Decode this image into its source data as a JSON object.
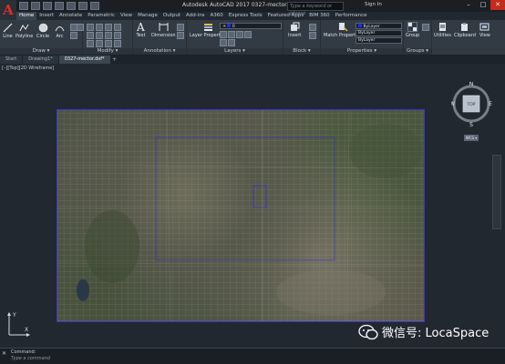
{
  "title_bar": {
    "logo_letter": "A",
    "window_title": "Autodesk AutoCAD 2017      0327-mector.dxf",
    "search_placeholder": "Type a keyword or phrase",
    "sign_in": "Sign In",
    "controls": [
      "–",
      "□",
      "✕"
    ]
  },
  "ribbon_tabs": [
    "Home",
    "Insert",
    "Annotate",
    "Parametric",
    "View",
    "Manage",
    "Output",
    "Add-ins",
    "A360",
    "Express Tools",
    "Featured Apps",
    "BIM 360",
    "Performance"
  ],
  "ribbon": {
    "draw": {
      "label": "Draw ▾",
      "tools": [
        "Line",
        "Polyline",
        "Circle",
        "Arc"
      ]
    },
    "modify": {
      "label": "Modify ▾"
    },
    "annotation": {
      "label": "Annotation ▾",
      "tools": [
        "Text",
        "Dimension"
      ]
    },
    "layers": {
      "label": "Layers ▾",
      "tools": [
        "Layer Properties"
      ],
      "layer_value": "0"
    },
    "block": {
      "label": "Block ▾",
      "tools": [
        "Insert"
      ]
    },
    "properties": {
      "label": "Properties ▾",
      "tools": [
        "Match Properties"
      ],
      "values": [
        "ByLayer",
        "ByLayer",
        "ByLayer"
      ]
    },
    "groups": {
      "label": "Groups ▾",
      "tools": [
        "Group"
      ]
    },
    "utilities": {
      "label": "Utilities"
    },
    "clipboard": {
      "label": "Clipboard"
    },
    "view": {
      "label": "View"
    }
  },
  "file_tabs": [
    "Start",
    "Drawing1*",
    "0327-mector.dxf*"
  ],
  "viewport": {
    "label": "[–][Top][2D Wireframe]",
    "viewcube": {
      "face": "TOP",
      "N": "N",
      "S": "S",
      "E": "E",
      "W": "W",
      "wcs": "WCS ▾"
    },
    "ucs": {
      "x": "X",
      "y": "Y"
    }
  },
  "command": {
    "label": "Command:",
    "input_placeholder": "Type a command"
  },
  "watermark": "微信号: LocaSpace",
  "colors": {
    "accent_red": "#e32a2a",
    "map_border": "#3a35d8",
    "background": "#212830"
  }
}
